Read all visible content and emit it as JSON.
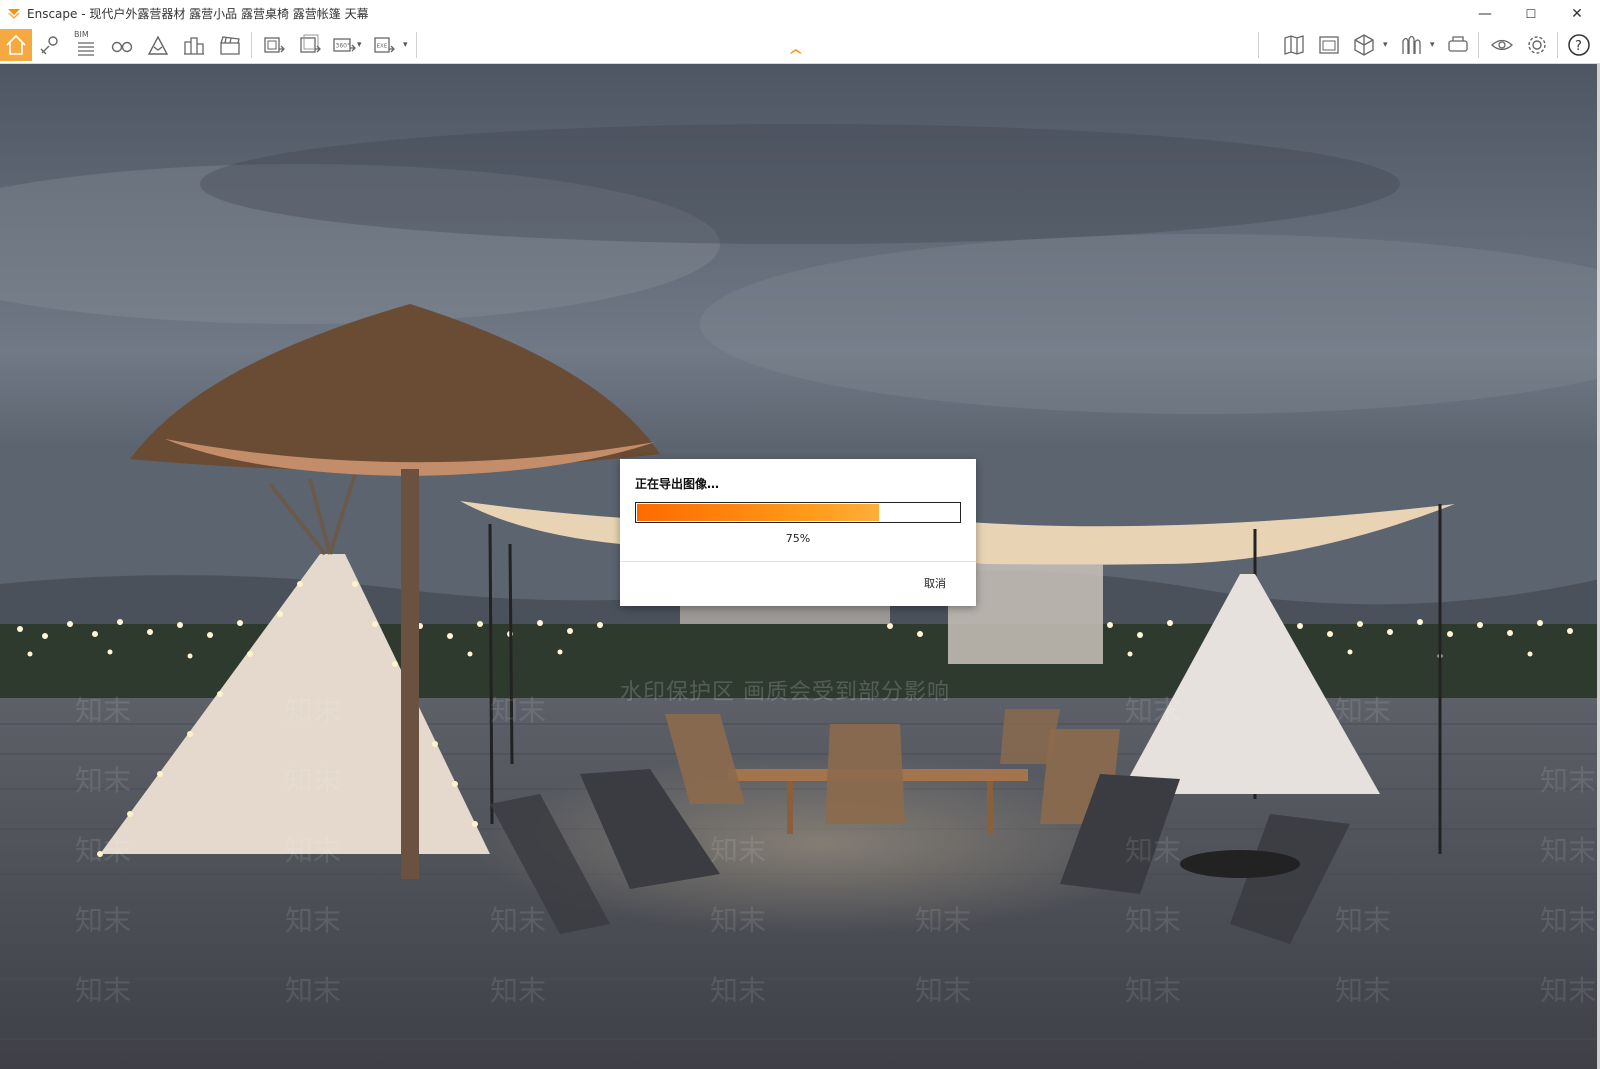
{
  "app": {
    "title": "Enscape - 现代户外露营器材 露营小品 露营桌椅 露营帐篷 天幕",
    "logo_icon": "enscape-logo-icon",
    "brand_color": "#f7a941"
  },
  "window_controls": {
    "minimize": "—",
    "maximize": "☐",
    "close": "✕"
  },
  "toolbar": {
    "bim_label": "BIM",
    "left_tools": [
      "home-icon",
      "pin-icon",
      "bim-icon",
      "binoculars-icon",
      "mountain-icon",
      "buildings-icon",
      "clapper-icon",
      "screenshot-icon",
      "batch-render-icon",
      "panorama-360-icon",
      "exe-export-icon"
    ],
    "right_tools": [
      "map-icon",
      "asset-library-icon",
      "cube-icon",
      "vegetation-icon",
      "vr-headset-icon",
      "eye-icon",
      "settings-icon",
      "help-icon"
    ],
    "panorama_label": "360°",
    "exe_label": "EXE"
  },
  "scene": {
    "watermark_center": "水印保护区   画质会受到部分影响",
    "watermark_tile": "知末"
  },
  "dialog": {
    "title": "正在导出图像…",
    "progress_percent": 75,
    "progress_label": "75%",
    "cancel_label": "取消"
  }
}
